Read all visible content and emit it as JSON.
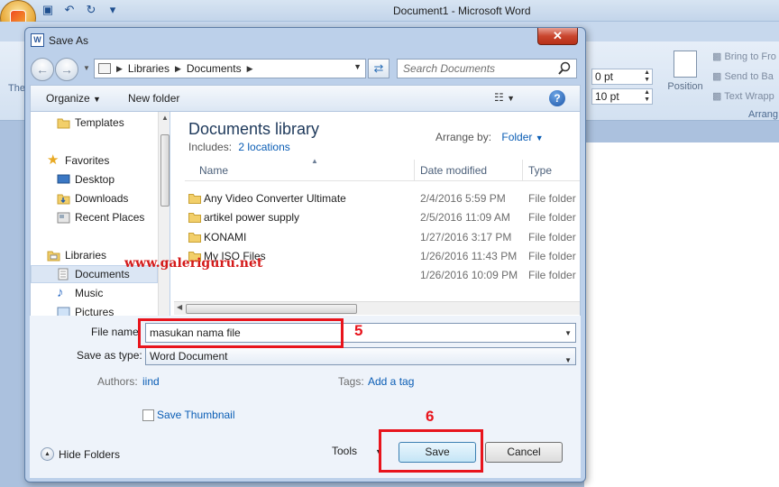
{
  "word": {
    "title": "Document1 - Microsoft Word",
    "ribbon": {
      "spacing_before": "0 pt",
      "spacing_after": "10 pt",
      "position_label": "Position",
      "bring_to_front": "Bring to Fro",
      "send_to_back": "Send to Ba",
      "text_wrapping": "Text Wrapp",
      "arrange_group": "Arrang",
      "left_label": "The"
    }
  },
  "dialog": {
    "title": "Save As",
    "close_glyph": "✕",
    "address": {
      "segments": [
        "Libraries",
        "Documents"
      ]
    },
    "search": {
      "placeholder": "Search Documents"
    },
    "toolbar": {
      "organize": "Organize",
      "new_folder": "New folder"
    },
    "nav_pane": {
      "items": [
        {
          "label": "Templates",
          "icon": "folder-icon"
        },
        {
          "label": "Favorites",
          "icon": "star-icon"
        },
        {
          "label": "Desktop",
          "icon": "desktop-icon"
        },
        {
          "label": "Downloads",
          "icon": "downloads-icon"
        },
        {
          "label": "Recent Places",
          "icon": "recent-places-icon"
        },
        {
          "label": "Libraries",
          "icon": "libraries-icon"
        },
        {
          "label": "Documents",
          "icon": "documents-icon",
          "selected": true
        },
        {
          "label": "Music",
          "icon": "music-icon"
        },
        {
          "label": "Pictures",
          "icon": "pictures-icon"
        }
      ]
    },
    "library": {
      "title": "Documents library",
      "includes_label": "Includes:",
      "includes_link": "2 locations",
      "arrange_label": "Arrange by:",
      "arrange_value": "Folder"
    },
    "columns": {
      "name": "Name",
      "date": "Date modified",
      "type": "Type"
    },
    "files": [
      {
        "name": "Any Video Converter Ultimate",
        "date": "2/4/2016 5:59 PM",
        "type": "File folder"
      },
      {
        "name": "artikel power supply",
        "date": "2/5/2016 11:09 AM",
        "type": "File folder"
      },
      {
        "name": "KONAMI",
        "date": "1/27/2016 3:17 PM",
        "type": "File folder"
      },
      {
        "name": "My ISO Files",
        "date": "1/26/2016 11:43 PM",
        "type": "File folder"
      },
      {
        "name": "",
        "date": "1/26/2016 10:09 PM",
        "type": "File folder"
      }
    ],
    "form": {
      "file_name_label": "File name:",
      "file_name_value": "masukan nama file",
      "save_as_type_label": "Save as type:",
      "save_as_type_value": "Word Document",
      "authors_label": "Authors:",
      "authors_value": "iind",
      "tags_label": "Tags:",
      "tags_value": "Add a tag",
      "save_thumbnail": "Save Thumbnail"
    },
    "footer": {
      "hide_folders": "Hide Folders",
      "tools": "Tools",
      "save": "Save",
      "cancel": "Cancel"
    }
  },
  "annotations": {
    "watermark": "www.galeriguru.net",
    "step_5": "5",
    "step_6": "6",
    "color": "#e8141c"
  }
}
